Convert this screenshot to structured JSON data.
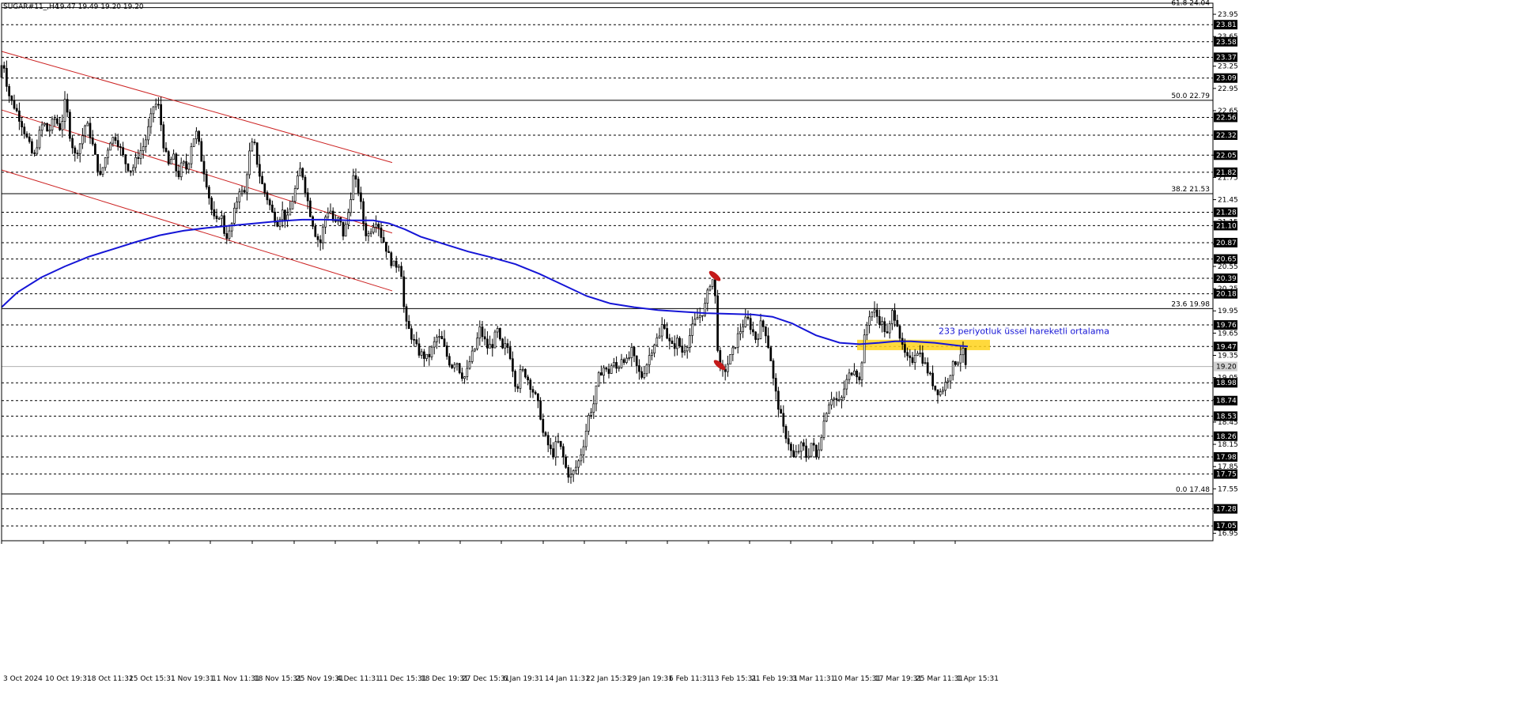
{
  "window": {
    "symbol_label": "SUGAR#11_,H4",
    "ohlc_label": "19.47 19.49 19.20 19.20"
  },
  "colors": {
    "background": "#ffffff",
    "candle": "#000000",
    "ema": "#1515d6",
    "channel": "#cc2222",
    "highlight": "#ffd21a",
    "annotation_text": "#1515d6",
    "arrow_marker": "#c41a1a",
    "dashed_level": "#000000",
    "price_tag_bg": "#000000",
    "price_tag_text": "#ffffff"
  },
  "chart_data": {
    "type": "candlestick",
    "symbol": "SUGAR#11",
    "timeframe": "H4",
    "ylim": [
      16.85,
      24.1
    ],
    "x_range": [
      0,
      1530
    ],
    "xlabels": [
      {
        "x": 0,
        "label": "3 Oct 2024"
      },
      {
        "x": 53,
        "label": "10 Oct 19:31"
      },
      {
        "x": 106,
        "label": "18 Oct 11:31"
      },
      {
        "x": 159,
        "label": "25 Oct 15:31"
      },
      {
        "x": 212,
        "label": "1 Nov 19:31"
      },
      {
        "x": 264,
        "label": "11 Nov 11:31"
      },
      {
        "x": 317,
        "label": "18 Nov 15:31"
      },
      {
        "x": 370,
        "label": "25 Nov 19:31"
      },
      {
        "x": 422,
        "label": "4 Dec 11:31"
      },
      {
        "x": 475,
        "label": "11 Dec 15:31"
      },
      {
        "x": 528,
        "label": "18 Dec 19:31"
      },
      {
        "x": 580,
        "label": "27 Dec 15:31"
      },
      {
        "x": 632,
        "label": "6 Jan 19:31"
      },
      {
        "x": 685,
        "label": "14 Jan 11:31"
      },
      {
        "x": 737,
        "label": "22 Jan 15:31"
      },
      {
        "x": 790,
        "label": "29 Jan 19:31"
      },
      {
        "x": 842,
        "label": "6 Feb 11:31"
      },
      {
        "x": 894,
        "label": "13 Feb 15:31"
      },
      {
        "x": 946,
        "label": "21 Feb 19:31"
      },
      {
        "x": 998,
        "label": "3 Mar 11:31"
      },
      {
        "x": 1050,
        "label": "10 Mar 15:31"
      },
      {
        "x": 1102,
        "label": "17 Mar 19:31"
      },
      {
        "x": 1154,
        "label": "25 Mar 11:31"
      },
      {
        "x": 1206,
        "label": "1 Apr 15:31"
      }
    ],
    "yticks": [
      {
        "value": 23.95,
        "label": "23.95"
      },
      {
        "value": 23.65,
        "label": "23.65"
      },
      {
        "value": 23.25,
        "label": "23.25"
      },
      {
        "value": 22.95,
        "label": "22.95"
      },
      {
        "value": 22.65,
        "label": "22.65"
      },
      {
        "value": 22.05,
        "label": "22.05"
      },
      {
        "value": 21.75,
        "label": "21.75"
      },
      {
        "value": 21.45,
        "label": "21.45"
      },
      {
        "value": 21.15,
        "label": "21.15"
      },
      {
        "value": 20.85,
        "label": "20.85"
      },
      {
        "value": 20.55,
        "label": "20.55"
      },
      {
        "value": 20.25,
        "label": "20.25"
      },
      {
        "value": 19.95,
        "label": "19.95"
      },
      {
        "value": 19.65,
        "label": "19.65"
      },
      {
        "value": 19.35,
        "label": "19.35"
      },
      {
        "value": 19.05,
        "label": "19.05"
      },
      {
        "value": 18.75,
        "label": "18.75"
      },
      {
        "value": 18.45,
        "label": "18.45"
      },
      {
        "value": 18.15,
        "label": "18.15"
      },
      {
        "value": 17.85,
        "label": "17.85"
      },
      {
        "value": 17.55,
        "label": "17.55"
      },
      {
        "value": 17.25,
        "label": "17.25"
      },
      {
        "value": 16.95,
        "label": "16.95"
      }
    ],
    "dashed_levels": [
      {
        "value": 23.81,
        "label": "23.81"
      },
      {
        "value": 23.58,
        "label": "23.58"
      },
      {
        "value": 23.37,
        "label": "23.37"
      },
      {
        "value": 23.09,
        "label": "23.09"
      },
      {
        "value": 22.56,
        "label": "22.56"
      },
      {
        "value": 22.32,
        "label": "22.32"
      },
      {
        "value": 22.05,
        "label": "22.05"
      },
      {
        "value": 21.82,
        "label": "21.82"
      },
      {
        "value": 21.28,
        "label": "21.28"
      },
      {
        "value": 21.1,
        "label": "21.10"
      },
      {
        "value": 20.87,
        "label": "20.87"
      },
      {
        "value": 20.65,
        "label": "20.65"
      },
      {
        "value": 20.39,
        "label": "20.39"
      },
      {
        "value": 20.18,
        "label": "20.18"
      },
      {
        "value": 19.76,
        "label": "19.76"
      },
      {
        "value": 19.47,
        "label": "19.47"
      },
      {
        "value": 18.98,
        "label": "18.98"
      },
      {
        "value": 18.74,
        "label": "18.74"
      },
      {
        "value": 18.53,
        "label": "18.53"
      },
      {
        "value": 18.26,
        "label": "18.26"
      },
      {
        "value": 17.98,
        "label": "17.98"
      },
      {
        "value": 17.75,
        "label": "17.75"
      },
      {
        "value": 17.28,
        "label": "17.28"
      },
      {
        "value": 17.05,
        "label": "17.05"
      }
    ],
    "current_price": {
      "value": 19.2,
      "label": "19.20"
    },
    "fib_levels": [
      {
        "value": 24.04,
        "label": "61.8 24.04"
      },
      {
        "value": 22.79,
        "label": "50.0 22.79"
      },
      {
        "value": 21.53,
        "label": "38.2 21.53"
      },
      {
        "value": 19.98,
        "label": "23.6 19.98"
      },
      {
        "value": 17.48,
        "label": "0.0 17.48"
      }
    ],
    "price_path": [
      [
        0,
        23.1
      ],
      [
        5,
        23.35
      ],
      [
        10,
        23.0
      ],
      [
        14,
        22.8
      ],
      [
        20,
        22.7
      ],
      [
        28,
        22.5
      ],
      [
        36,
        22.25
      ],
      [
        44,
        22.0
      ],
      [
        50,
        22.3
      ],
      [
        56,
        22.5
      ],
      [
        62,
        22.35
      ],
      [
        70,
        22.55
      ],
      [
        78,
        22.4
      ],
      [
        84,
        22.8
      ],
      [
        90,
        22.3
      ],
      [
        96,
        22.05
      ],
      [
        104,
        22.25
      ],
      [
        110,
        22.5
      ],
      [
        116,
        22.3
      ],
      [
        122,
        22.0
      ],
      [
        128,
        21.75
      ],
      [
        134,
        22.0
      ],
      [
        140,
        22.25
      ],
      [
        148,
        22.3
      ],
      [
        156,
        22.05
      ],
      [
        162,
        21.9
      ],
      [
        168,
        21.85
      ],
      [
        176,
        22.05
      ],
      [
        184,
        22.2
      ],
      [
        190,
        22.45
      ],
      [
        196,
        22.75
      ],
      [
        202,
        22.7
      ],
      [
        208,
        22.2
      ],
      [
        214,
        21.9
      ],
      [
        220,
        22.05
      ],
      [
        226,
        21.75
      ],
      [
        232,
        21.95
      ],
      [
        238,
        21.85
      ],
      [
        244,
        22.25
      ],
      [
        250,
        22.35
      ],
      [
        256,
        22.0
      ],
      [
        262,
        21.7
      ],
      [
        268,
        21.35
      ],
      [
        274,
        21.1
      ],
      [
        280,
        21.3
      ],
      [
        286,
        20.95
      ],
      [
        292,
        21.0
      ],
      [
        298,
        21.3
      ],
      [
        304,
        21.6
      ],
      [
        310,
        21.5
      ],
      [
        316,
        22.05
      ],
      [
        322,
        22.25
      ],
      [
        328,
        21.85
      ],
      [
        334,
        21.6
      ],
      [
        340,
        21.45
      ],
      [
        346,
        21.25
      ],
      [
        352,
        21.15
      ],
      [
        358,
        21.3
      ],
      [
        364,
        21.15
      ],
      [
        370,
        21.4
      ],
      [
        376,
        21.65
      ],
      [
        382,
        21.9
      ],
      [
        388,
        21.55
      ],
      [
        394,
        21.25
      ],
      [
        400,
        21.0
      ],
      [
        406,
        20.85
      ],
      [
        412,
        21.2
      ],
      [
        418,
        21.35
      ],
      [
        424,
        21.1
      ],
      [
        430,
        21.2
      ],
      [
        436,
        20.95
      ],
      [
        442,
        21.3
      ],
      [
        448,
        21.75
      ],
      [
        454,
        21.6
      ],
      [
        458,
        21.35
      ],
      [
        462,
        21.05
      ],
      [
        466,
        20.95
      ],
      [
        472,
        21.1
      ],
      [
        478,
        21.2
      ],
      [
        482,
        21.0
      ],
      [
        488,
        20.85
      ],
      [
        494,
        20.65
      ],
      [
        500,
        20.55
      ],
      [
        506,
        20.6
      ],
      [
        510,
        20.4
      ],
      [
        513,
        19.8
      ],
      [
        518,
        19.7
      ],
      [
        524,
        19.55
      ],
      [
        530,
        19.4
      ],
      [
        536,
        19.35
      ],
      [
        542,
        19.3
      ],
      [
        548,
        19.45
      ],
      [
        554,
        19.6
      ],
      [
        560,
        19.55
      ],
      [
        566,
        19.35
      ],
      [
        572,
        19.2
      ],
      [
        578,
        19.3
      ],
      [
        584,
        19.1
      ],
      [
        590,
        19.05
      ],
      [
        596,
        19.3
      ],
      [
        602,
        19.45
      ],
      [
        608,
        19.7
      ],
      [
        612,
        19.6
      ],
      [
        618,
        19.45
      ],
      [
        624,
        19.5
      ],
      [
        630,
        19.7
      ],
      [
        636,
        19.4
      ],
      [
        642,
        19.5
      ],
      [
        648,
        19.3
      ],
      [
        652,
        19.0
      ],
      [
        656,
        18.95
      ],
      [
        660,
        19.15
      ],
      [
        666,
        19.1
      ],
      [
        672,
        18.95
      ],
      [
        678,
        18.8
      ],
      [
        684,
        18.6
      ],
      [
        688,
        18.3
      ],
      [
        694,
        18.15
      ],
      [
        700,
        18.0
      ],
      [
        706,
        18.2
      ],
      [
        712,
        18.05
      ],
      [
        716,
        17.85
      ],
      [
        722,
        17.7
      ],
      [
        728,
        17.8
      ],
      [
        734,
        17.95
      ],
      [
        740,
        18.2
      ],
      [
        746,
        18.55
      ],
      [
        752,
        18.7
      ],
      [
        758,
        19.05
      ],
      [
        764,
        19.2
      ],
      [
        770,
        19.1
      ],
      [
        776,
        19.25
      ],
      [
        782,
        19.15
      ],
      [
        788,
        19.35
      ],
      [
        794,
        19.25
      ],
      [
        800,
        19.4
      ],
      [
        806,
        19.2
      ],
      [
        812,
        19.05
      ],
      [
        818,
        19.2
      ],
      [
        824,
        19.4
      ],
      [
        830,
        19.55
      ],
      [
        836,
        19.6
      ],
      [
        840,
        19.85
      ],
      [
        846,
        19.55
      ],
      [
        852,
        19.45
      ],
      [
        858,
        19.55
      ],
      [
        864,
        19.4
      ],
      [
        870,
        19.5
      ],
      [
        876,
        19.7
      ],
      [
        882,
        19.85
      ],
      [
        888,
        19.9
      ],
      [
        894,
        20.05
      ],
      [
        898,
        20.3
      ],
      [
        902,
        20.4
      ],
      [
        906,
        20.1
      ],
      [
        910,
        19.2
      ],
      [
        916,
        19.1
      ],
      [
        922,
        19.25
      ],
      [
        928,
        19.4
      ],
      [
        934,
        19.6
      ],
      [
        940,
        19.75
      ],
      [
        946,
        19.85
      ],
      [
        952,
        19.7
      ],
      [
        958,
        19.55
      ],
      [
        964,
        19.8
      ],
      [
        970,
        19.65
      ],
      [
        976,
        19.3
      ],
      [
        980,
        18.95
      ],
      [
        986,
        18.65
      ],
      [
        992,
        18.35
      ],
      [
        998,
        18.2
      ],
      [
        1004,
        17.95
      ],
      [
        1010,
        18.05
      ],
      [
        1016,
        18.15
      ],
      [
        1022,
        17.95
      ],
      [
        1028,
        18.2
      ],
      [
        1034,
        17.95
      ],
      [
        1040,
        18.3
      ],
      [
        1046,
        18.6
      ],
      [
        1052,
        18.8
      ],
      [
        1058,
        18.75
      ],
      [
        1064,
        18.7
      ],
      [
        1070,
        18.95
      ],
      [
        1076,
        19.1
      ],
      [
        1082,
        19.2
      ],
      [
        1088,
        19.0
      ],
      [
        1094,
        19.55
      ],
      [
        1100,
        19.9
      ],
      [
        1106,
        19.95
      ],
      [
        1112,
        19.85
      ],
      [
        1118,
        19.75
      ],
      [
        1124,
        19.6
      ],
      [
        1130,
        19.95
      ],
      [
        1136,
        19.8
      ],
      [
        1142,
        19.45
      ],
      [
        1148,
        19.3
      ],
      [
        1154,
        19.25
      ],
      [
        1160,
        19.45
      ],
      [
        1166,
        19.35
      ],
      [
        1172,
        19.2
      ],
      [
        1178,
        19.05
      ],
      [
        1184,
        18.9
      ],
      [
        1190,
        18.85
      ],
      [
        1196,
        18.95
      ],
      [
        1202,
        19.1
      ],
      [
        1208,
        19.25
      ],
      [
        1214,
        19.3
      ],
      [
        1218,
        19.47
      ],
      [
        1222,
        19.2
      ]
    ],
    "ema": {
      "name": "233 periyotluk üssel hareketli ortalama",
      "points": [
        [
          0,
          20.0
        ],
        [
          20,
          20.2
        ],
        [
          50,
          20.4
        ],
        [
          80,
          20.55
        ],
        [
          110,
          20.68
        ],
        [
          140,
          20.78
        ],
        [
          170,
          20.88
        ],
        [
          200,
          20.97
        ],
        [
          230,
          21.03
        ],
        [
          260,
          21.07
        ],
        [
          290,
          21.1
        ],
        [
          320,
          21.13
        ],
        [
          350,
          21.16
        ],
        [
          380,
          21.18
        ],
        [
          410,
          21.18
        ],
        [
          440,
          21.17
        ],
        [
          470,
          21.17
        ],
        [
          490,
          21.13
        ],
        [
          510,
          21.05
        ],
        [
          530,
          20.95
        ],
        [
          560,
          20.85
        ],
        [
          590,
          20.75
        ],
        [
          620,
          20.67
        ],
        [
          650,
          20.58
        ],
        [
          680,
          20.45
        ],
        [
          710,
          20.3
        ],
        [
          740,
          20.15
        ],
        [
          770,
          20.05
        ],
        [
          800,
          20.0
        ],
        [
          830,
          19.96
        ],
        [
          860,
          19.94
        ],
        [
          890,
          19.92
        ],
        [
          920,
          19.91
        ],
        [
          950,
          19.9
        ],
        [
          975,
          19.87
        ],
        [
          1000,
          19.78
        ],
        [
          1030,
          19.62
        ],
        [
          1060,
          19.52
        ],
        [
          1085,
          19.5
        ],
        [
          1110,
          19.52
        ],
        [
          1130,
          19.54
        ],
        [
          1150,
          19.54
        ],
        [
          1180,
          19.52
        ],
        [
          1210,
          19.48
        ],
        [
          1222,
          19.47
        ]
      ]
    },
    "channel_lines": [
      {
        "from": [
          0,
          23.45
        ],
        "to": [
          494,
          21.95
        ]
      },
      {
        "from": [
          0,
          22.66
        ],
        "to": [
          494,
          21.0
        ]
      },
      {
        "from": [
          0,
          21.85
        ],
        "to": [
          494,
          20.22
        ]
      }
    ],
    "highlight_zone": {
      "x0": 1082,
      "x1": 1250,
      "y_top": 19.56,
      "y_bottom": 19.42
    },
    "annotation": {
      "text": "233 periyotluk üssel hareketli ortalama",
      "x": 1185,
      "value": 19.64
    },
    "arrow_markers": [
      {
        "x": 902,
        "value": 20.42,
        "direction": "down-right"
      },
      {
        "x": 908,
        "value": 19.22,
        "direction": "down-right"
      }
    ]
  }
}
